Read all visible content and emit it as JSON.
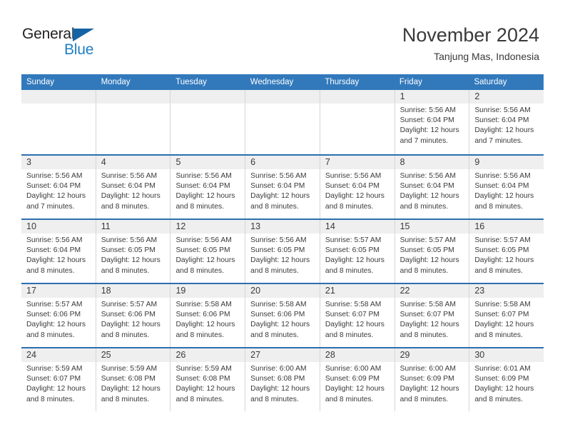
{
  "logo": {
    "text_primary": "General",
    "text_secondary": "Blue",
    "triangle_icon": "triangle-icon",
    "primary_color": "#231f20",
    "secondary_color": "#1f7fc4",
    "triangle_color": "#1464a5"
  },
  "header": {
    "title": "November 2024",
    "subtitle": "Tanjung Mas, Indonesia"
  },
  "theme": {
    "header_bar_color": "#3279bc",
    "row_divider_color": "#2c6fae",
    "daynum_band_color": "#efefef",
    "cell_divider_color": "#d6d6d6",
    "text_color": "#3a3a3a"
  },
  "weekdays": [
    "Sunday",
    "Monday",
    "Tuesday",
    "Wednesday",
    "Thursday",
    "Friday",
    "Saturday"
  ],
  "weeks": [
    [
      {
        "empty": true
      },
      {
        "empty": true
      },
      {
        "empty": true
      },
      {
        "empty": true
      },
      {
        "empty": true
      },
      {
        "day": "1",
        "sunrise": "Sunrise: 5:56 AM",
        "sunset": "Sunset: 6:04 PM",
        "daylight_line1": "Daylight: 12 hours",
        "daylight_line2": "and 7 minutes."
      },
      {
        "day": "2",
        "sunrise": "Sunrise: 5:56 AM",
        "sunset": "Sunset: 6:04 PM",
        "daylight_line1": "Daylight: 12 hours",
        "daylight_line2": "and 7 minutes."
      }
    ],
    [
      {
        "day": "3",
        "sunrise": "Sunrise: 5:56 AM",
        "sunset": "Sunset: 6:04 PM",
        "daylight_line1": "Daylight: 12 hours",
        "daylight_line2": "and 7 minutes."
      },
      {
        "day": "4",
        "sunrise": "Sunrise: 5:56 AM",
        "sunset": "Sunset: 6:04 PM",
        "daylight_line1": "Daylight: 12 hours",
        "daylight_line2": "and 8 minutes."
      },
      {
        "day": "5",
        "sunrise": "Sunrise: 5:56 AM",
        "sunset": "Sunset: 6:04 PM",
        "daylight_line1": "Daylight: 12 hours",
        "daylight_line2": "and 8 minutes."
      },
      {
        "day": "6",
        "sunrise": "Sunrise: 5:56 AM",
        "sunset": "Sunset: 6:04 PM",
        "daylight_line1": "Daylight: 12 hours",
        "daylight_line2": "and 8 minutes."
      },
      {
        "day": "7",
        "sunrise": "Sunrise: 5:56 AM",
        "sunset": "Sunset: 6:04 PM",
        "daylight_line1": "Daylight: 12 hours",
        "daylight_line2": "and 8 minutes."
      },
      {
        "day": "8",
        "sunrise": "Sunrise: 5:56 AM",
        "sunset": "Sunset: 6:04 PM",
        "daylight_line1": "Daylight: 12 hours",
        "daylight_line2": "and 8 minutes."
      },
      {
        "day": "9",
        "sunrise": "Sunrise: 5:56 AM",
        "sunset": "Sunset: 6:04 PM",
        "daylight_line1": "Daylight: 12 hours",
        "daylight_line2": "and 8 minutes."
      }
    ],
    [
      {
        "day": "10",
        "sunrise": "Sunrise: 5:56 AM",
        "sunset": "Sunset: 6:04 PM",
        "daylight_line1": "Daylight: 12 hours",
        "daylight_line2": "and 8 minutes."
      },
      {
        "day": "11",
        "sunrise": "Sunrise: 5:56 AM",
        "sunset": "Sunset: 6:05 PM",
        "daylight_line1": "Daylight: 12 hours",
        "daylight_line2": "and 8 minutes."
      },
      {
        "day": "12",
        "sunrise": "Sunrise: 5:56 AM",
        "sunset": "Sunset: 6:05 PM",
        "daylight_line1": "Daylight: 12 hours",
        "daylight_line2": "and 8 minutes."
      },
      {
        "day": "13",
        "sunrise": "Sunrise: 5:56 AM",
        "sunset": "Sunset: 6:05 PM",
        "daylight_line1": "Daylight: 12 hours",
        "daylight_line2": "and 8 minutes."
      },
      {
        "day": "14",
        "sunrise": "Sunrise: 5:57 AM",
        "sunset": "Sunset: 6:05 PM",
        "daylight_line1": "Daylight: 12 hours",
        "daylight_line2": "and 8 minutes."
      },
      {
        "day": "15",
        "sunrise": "Sunrise: 5:57 AM",
        "sunset": "Sunset: 6:05 PM",
        "daylight_line1": "Daylight: 12 hours",
        "daylight_line2": "and 8 minutes."
      },
      {
        "day": "16",
        "sunrise": "Sunrise: 5:57 AM",
        "sunset": "Sunset: 6:05 PM",
        "daylight_line1": "Daylight: 12 hours",
        "daylight_line2": "and 8 minutes."
      }
    ],
    [
      {
        "day": "17",
        "sunrise": "Sunrise: 5:57 AM",
        "sunset": "Sunset: 6:06 PM",
        "daylight_line1": "Daylight: 12 hours",
        "daylight_line2": "and 8 minutes."
      },
      {
        "day": "18",
        "sunrise": "Sunrise: 5:57 AM",
        "sunset": "Sunset: 6:06 PM",
        "daylight_line1": "Daylight: 12 hours",
        "daylight_line2": "and 8 minutes."
      },
      {
        "day": "19",
        "sunrise": "Sunrise: 5:58 AM",
        "sunset": "Sunset: 6:06 PM",
        "daylight_line1": "Daylight: 12 hours",
        "daylight_line2": "and 8 minutes."
      },
      {
        "day": "20",
        "sunrise": "Sunrise: 5:58 AM",
        "sunset": "Sunset: 6:06 PM",
        "daylight_line1": "Daylight: 12 hours",
        "daylight_line2": "and 8 minutes."
      },
      {
        "day": "21",
        "sunrise": "Sunrise: 5:58 AM",
        "sunset": "Sunset: 6:07 PM",
        "daylight_line1": "Daylight: 12 hours",
        "daylight_line2": "and 8 minutes."
      },
      {
        "day": "22",
        "sunrise": "Sunrise: 5:58 AM",
        "sunset": "Sunset: 6:07 PM",
        "daylight_line1": "Daylight: 12 hours",
        "daylight_line2": "and 8 minutes."
      },
      {
        "day": "23",
        "sunrise": "Sunrise: 5:58 AM",
        "sunset": "Sunset: 6:07 PM",
        "daylight_line1": "Daylight: 12 hours",
        "daylight_line2": "and 8 minutes."
      }
    ],
    [
      {
        "day": "24",
        "sunrise": "Sunrise: 5:59 AM",
        "sunset": "Sunset: 6:07 PM",
        "daylight_line1": "Daylight: 12 hours",
        "daylight_line2": "and 8 minutes."
      },
      {
        "day": "25",
        "sunrise": "Sunrise: 5:59 AM",
        "sunset": "Sunset: 6:08 PM",
        "daylight_line1": "Daylight: 12 hours",
        "daylight_line2": "and 8 minutes."
      },
      {
        "day": "26",
        "sunrise": "Sunrise: 5:59 AM",
        "sunset": "Sunset: 6:08 PM",
        "daylight_line1": "Daylight: 12 hours",
        "daylight_line2": "and 8 minutes."
      },
      {
        "day": "27",
        "sunrise": "Sunrise: 6:00 AM",
        "sunset": "Sunset: 6:08 PM",
        "daylight_line1": "Daylight: 12 hours",
        "daylight_line2": "and 8 minutes."
      },
      {
        "day": "28",
        "sunrise": "Sunrise: 6:00 AM",
        "sunset": "Sunset: 6:09 PM",
        "daylight_line1": "Daylight: 12 hours",
        "daylight_line2": "and 8 minutes."
      },
      {
        "day": "29",
        "sunrise": "Sunrise: 6:00 AM",
        "sunset": "Sunset: 6:09 PM",
        "daylight_line1": "Daylight: 12 hours",
        "daylight_line2": "and 8 minutes."
      },
      {
        "day": "30",
        "sunrise": "Sunrise: 6:01 AM",
        "sunset": "Sunset: 6:09 PM",
        "daylight_line1": "Daylight: 12 hours",
        "daylight_line2": "and 8 minutes."
      }
    ]
  ]
}
